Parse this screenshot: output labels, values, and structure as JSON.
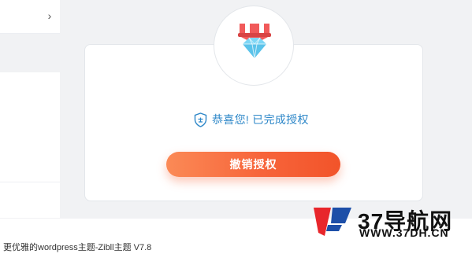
{
  "sidebar": {
    "chevron": "›"
  },
  "auth_card": {
    "status_text": "恭喜您! 已完成授权",
    "revoke_label": "撤销授权"
  },
  "footer": {
    "text": "更优雅的wordpress主题-Zibll主题 V7.8"
  },
  "watermark": {
    "title": "37导航网",
    "url": "WWW.37DH.CN"
  },
  "colors": {
    "accent_blue": "#2d87c8",
    "button_start": "#fb8a56",
    "button_end": "#f2542a",
    "badge_red": "#f15a5a",
    "diamond_blue": "#6fd0f2"
  }
}
